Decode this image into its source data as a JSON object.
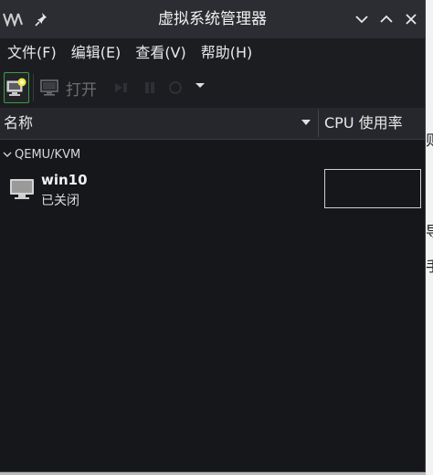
{
  "window": {
    "title": "虚拟系统管理器"
  },
  "menubar": {
    "items": [
      "文件(F)",
      "编辑(E)",
      "查看(V)",
      "帮助(H)"
    ]
  },
  "toolbar": {
    "open_label": "打开"
  },
  "columns": {
    "name": "名称",
    "cpu": "CPU 使用率"
  },
  "tree": {
    "group_label": "QEMU/KVM",
    "vms": [
      {
        "name": "win10",
        "status": "已关闭"
      }
    ]
  },
  "colors": {
    "window_bg": "#16171b",
    "titlebar_bg": "#2b2d32",
    "accent_green": "#3e9c43"
  },
  "icons": [
    "app-logo",
    "pin-icon",
    "chevron-down-icon",
    "chevron-up-icon",
    "close-icon",
    "new-vm-icon",
    "monitor-icon",
    "play-icon",
    "pause-icon",
    "stop-icon",
    "dropdown-arrow-icon",
    "sort-arrow-icon",
    "chevron-down-icon",
    "vm-monitor-icon"
  ]
}
